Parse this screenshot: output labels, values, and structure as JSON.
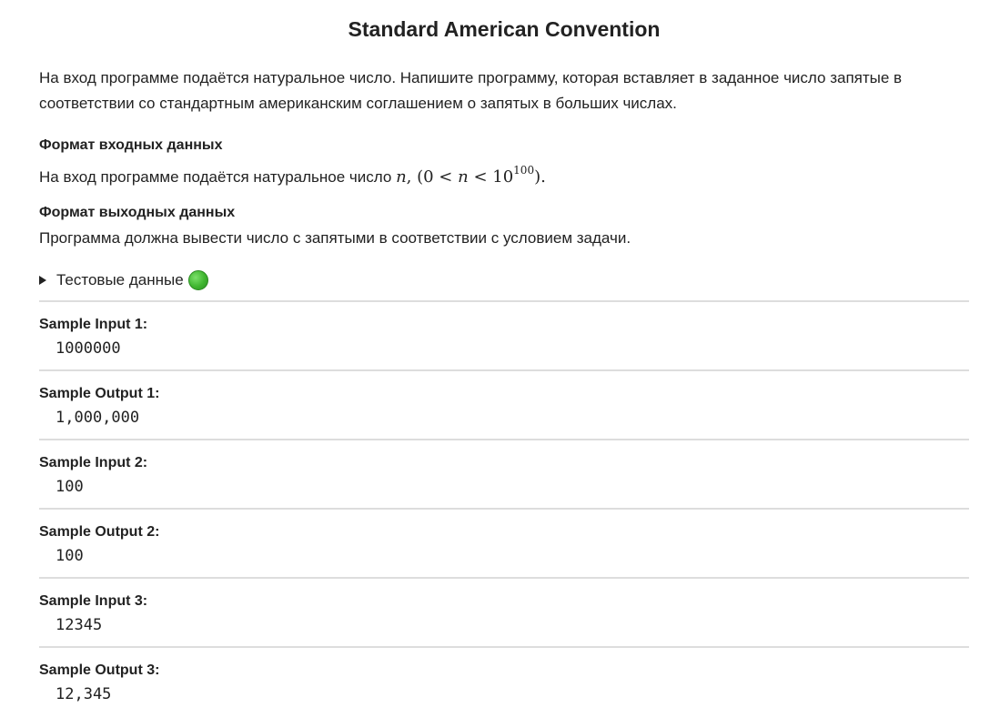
{
  "problem": {
    "title": "Standard American Convention",
    "statement": "На вход программе подаётся натуральное число. Напишите программу, которая вставляет в заданное число запятые в соответствии со стандартным американским соглашением о запятых в больших числах.",
    "input_format": {
      "heading": "Формат входных данных",
      "text": "На вход программе подаётся натуральное число",
      "math_var": "n",
      "math_open": "(0 <",
      "math_mid": "< 10",
      "math_exp": "100",
      "math_close": ")."
    },
    "output_format": {
      "heading": "Формат выходных данных",
      "text": "Программа должна вывести число с запятыми в соответствии с условием задачи."
    },
    "tests": {
      "label": "Тестовые данные",
      "status_color": "#3fb52f"
    },
    "samples": [
      {
        "label": "Sample Input 1:",
        "value": "1000000"
      },
      {
        "label": "Sample Output 1:",
        "value": "1,000,000"
      },
      {
        "label": "Sample Input 2:",
        "value": "100"
      },
      {
        "label": "Sample Output 2:",
        "value": "100"
      },
      {
        "label": "Sample Input 3:",
        "value": "12345"
      },
      {
        "label": "Sample Output 3:",
        "value": "12,345"
      }
    ]
  }
}
